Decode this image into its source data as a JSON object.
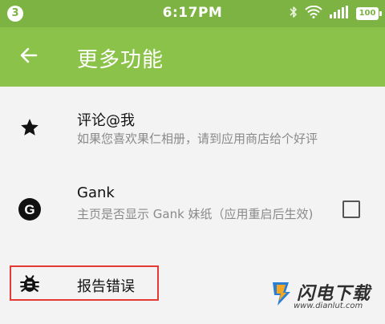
{
  "status_bar": {
    "notification_count": "3",
    "time": "6:17PM",
    "battery": "100",
    "icons": [
      "bluetooth-icon",
      "wifi-icon",
      "signal-icon",
      "battery-icon"
    ]
  },
  "app_bar": {
    "title": "更多功能",
    "back_icon": "arrow-left-icon"
  },
  "settings": [
    {
      "icon": "star-icon",
      "title": "评论@我",
      "subtitle": "如果您喜欢果仁相册，请到应用商店给个好评"
    },
    {
      "icon": "gank-logo-icon",
      "icon_letter": "G",
      "title": "Gank",
      "subtitle": "主页是否显示 Gank 妹纸（应用重启后生效)",
      "checked": false
    },
    {
      "icon": "bug-icon",
      "title": "报告错误",
      "highlighted": true
    }
  ],
  "watermark": {
    "name": "闪电下载",
    "url": "www.dianlut.com"
  },
  "colors": {
    "status_bar": "#7cb342",
    "app_bar": "#8bc34a",
    "background": "#f3f3f3",
    "highlight_border": "#e53935",
    "logo_orange": "#f5a623",
    "logo_blue": "#2a7fd4"
  }
}
